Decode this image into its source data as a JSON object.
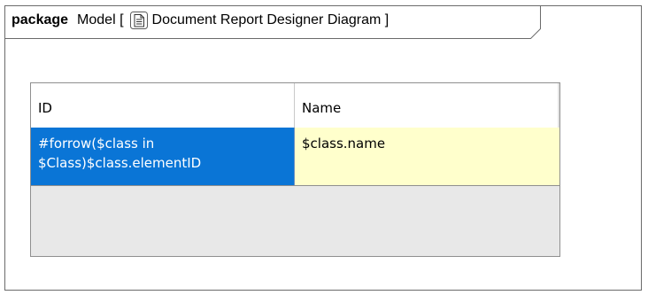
{
  "diagram": {
    "keyword": "package",
    "name_prefix": "Model [",
    "diagram_type_icon": "document-icon",
    "title": "Document Report Designer Diagram ]"
  },
  "table": {
    "columns": [
      {
        "label": "ID"
      },
      {
        "label": "Name"
      }
    ],
    "rows": [
      {
        "id_line1": "#forrow($class in",
        "id_line2": "$Class)$class.elementID",
        "name": "$class.name"
      }
    ]
  },
  "colors": {
    "selected_cell": "#0a75d6",
    "highlight_cell": "#ffffcc",
    "empty_area": "#e8e8e8"
  }
}
